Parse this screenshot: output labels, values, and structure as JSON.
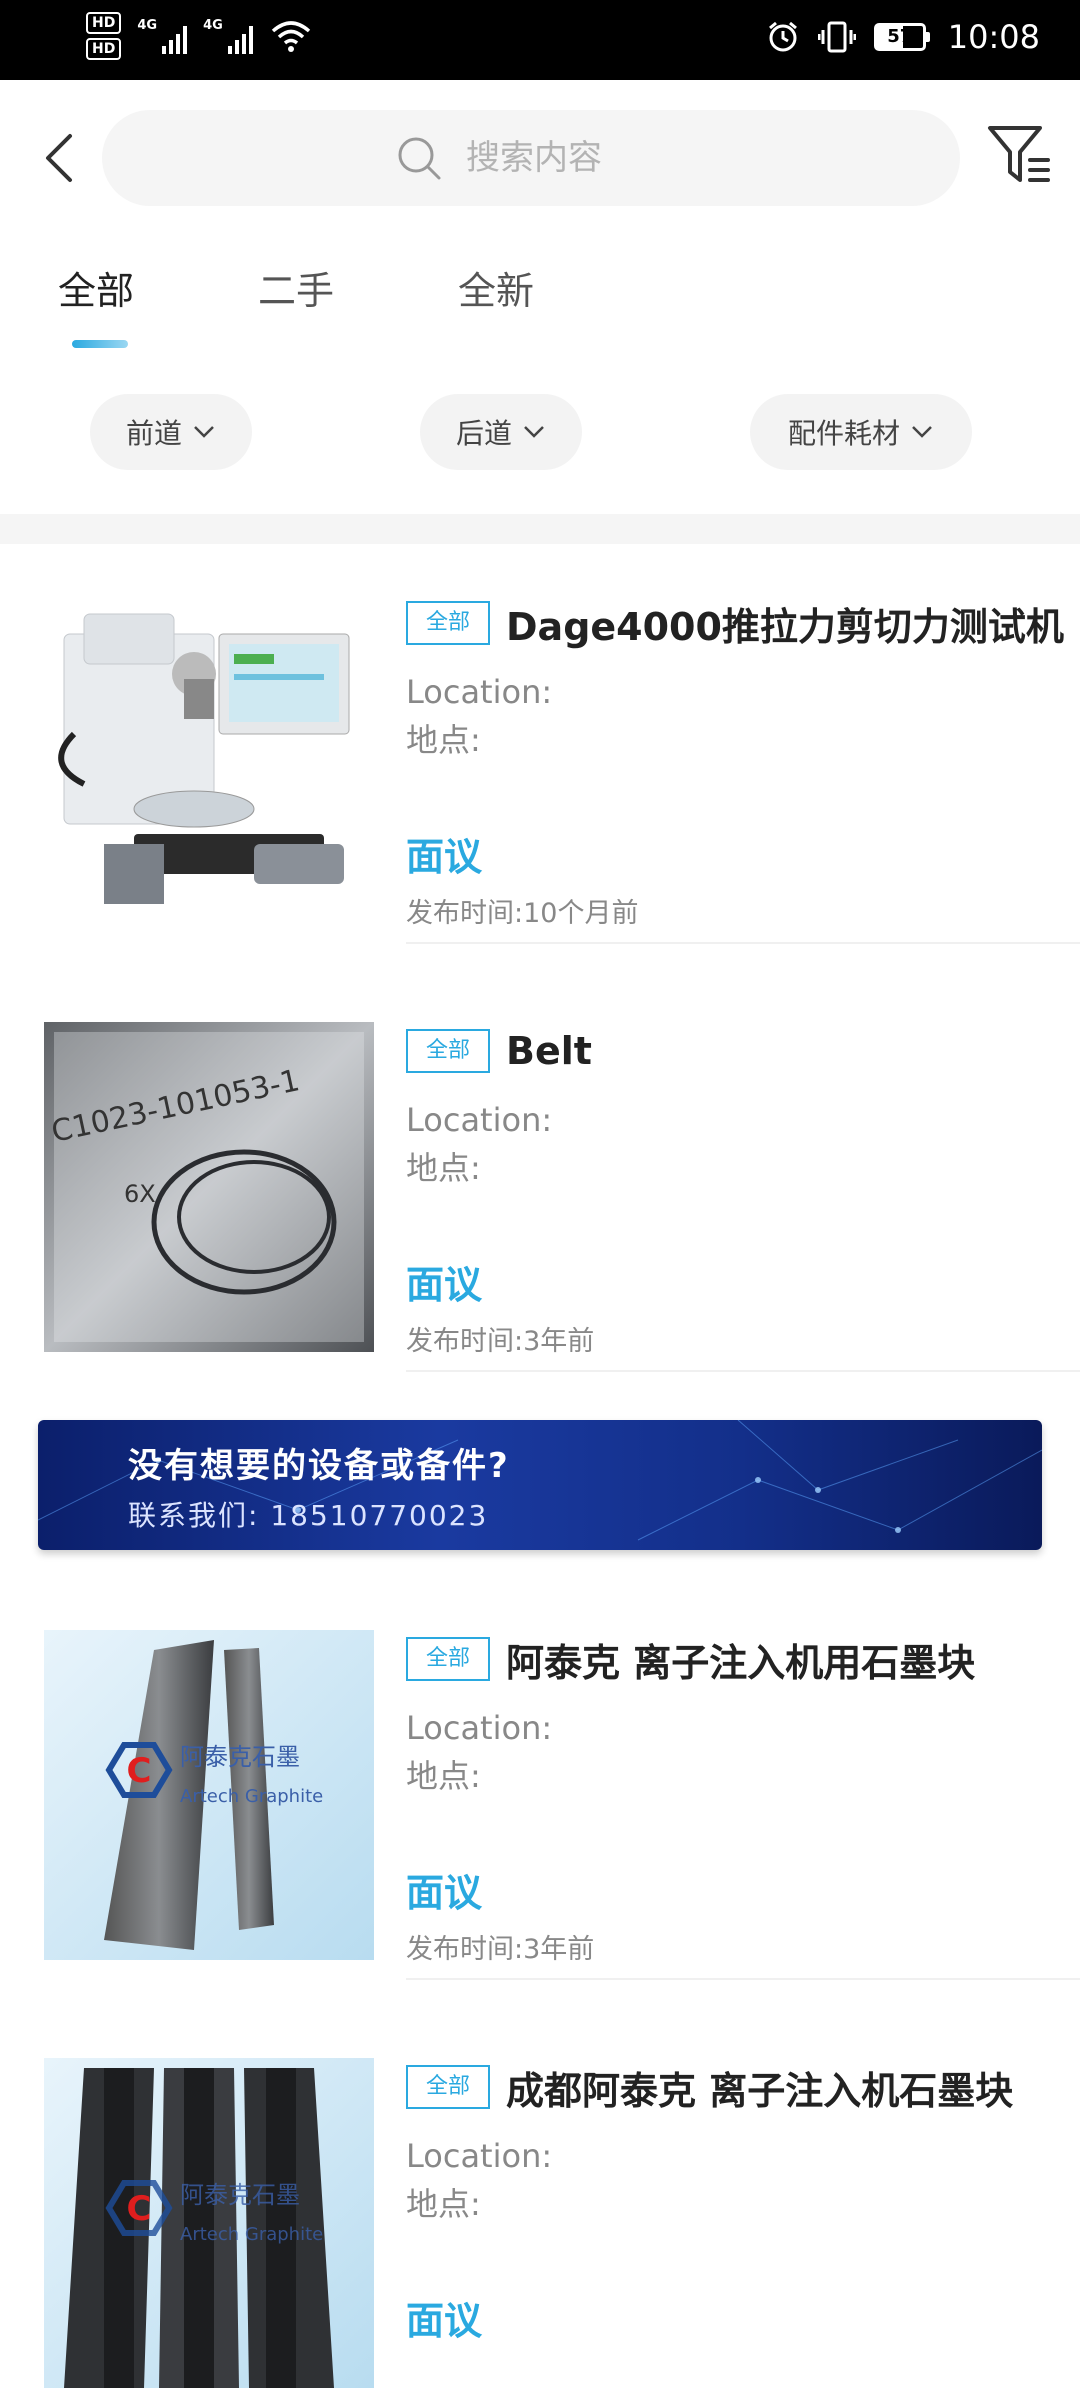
{
  "status_bar": {
    "hd1": "HD",
    "hd2": "HD",
    "net1": "4G",
    "net2": "4G",
    "battery": "57",
    "time": "10:08"
  },
  "search": {
    "placeholder": "搜索内容"
  },
  "tabs": [
    {
      "label": "全部",
      "active": true
    },
    {
      "label": "二手",
      "active": false
    },
    {
      "label": "全新",
      "active": false
    }
  ],
  "filters": [
    {
      "label": "前道"
    },
    {
      "label": "后道"
    },
    {
      "label": "配件耗材"
    }
  ],
  "items": [
    {
      "tag": "全部",
      "title": "Dage4000推拉力剪切力测试机",
      "location": "Location:",
      "place": "地点:",
      "price": "面议",
      "time": "发布时间:10个月前",
      "image": "microscope-tester"
    },
    {
      "tag": "全部",
      "title": "Belt",
      "location": "Location:",
      "place": "地点:",
      "price": "面议",
      "time": "发布时间:3年前",
      "image": "belt-in-bag"
    },
    {
      "tag": "全部",
      "title": "阿泰克 离子注入机用石墨块",
      "location": "Location:",
      "place": "地点:",
      "price": "面议",
      "time": "发布时间:3年前",
      "image": "graphite-blocks"
    },
    {
      "tag": "全部",
      "title": "成都阿泰克 离子注入机石墨块",
      "location": "Location:",
      "place": "地点:",
      "price": "面议",
      "time": "",
      "image": "graphite-channels"
    }
  ],
  "banner": {
    "title": "没有想要的设备或备件?",
    "subtitle": "联系我们: 18510770023"
  },
  "thumb_text": {
    "bag_label": "C1023-101053-1",
    "bag_mark": "6X",
    "logo_cn": "阿泰克石墨",
    "logo_en": "Artech Graphite",
    "logo_letter": "C"
  },
  "colors": {
    "accent": "#2aa9e0",
    "banner": "#1a3aa0"
  }
}
